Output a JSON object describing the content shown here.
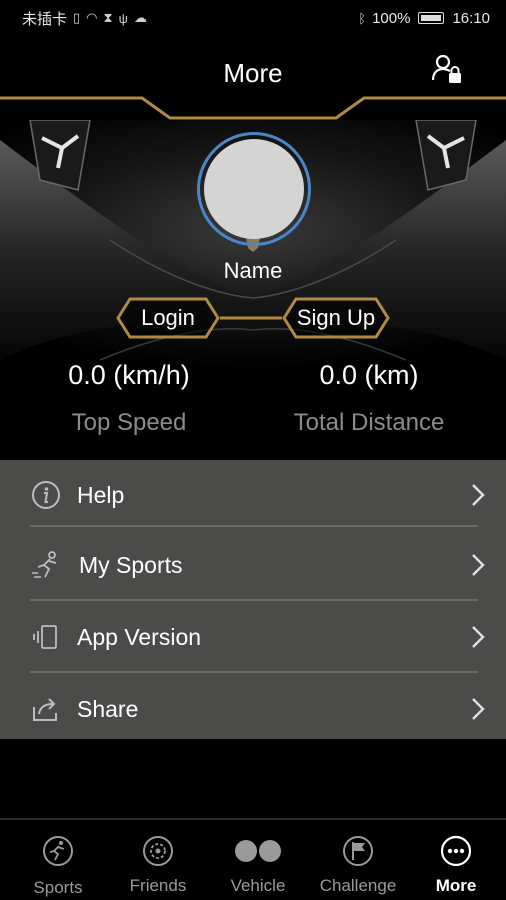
{
  "status_bar": {
    "carrier": "未插卡",
    "battery_percent": "100%",
    "time": "16:10"
  },
  "header": {
    "title": "More",
    "accent_color": "#b08a45"
  },
  "profile": {
    "name": "Name",
    "login_label": "Login",
    "signup_label": "Sign Up",
    "avatar_ring_color": "#4b86c9"
  },
  "stats": {
    "top_speed_value": "0.0 (km/h)",
    "top_speed_label": "Top Speed",
    "total_distance_value": "0.0 (km)",
    "total_distance_label": "Total Distance"
  },
  "menu": {
    "items": [
      {
        "label": "Help",
        "icon": "info-icon"
      },
      {
        "label": "My Sports",
        "icon": "runner-icon"
      },
      {
        "label": "App Version",
        "icon": "phone-version-icon"
      },
      {
        "label": "Share",
        "icon": "share-icon"
      }
    ]
  },
  "bottom_nav": {
    "items": [
      {
        "label": "Sports",
        "icon": "sports-icon",
        "active": false
      },
      {
        "label": "Friends",
        "icon": "friends-icon",
        "active": false
      },
      {
        "label": "Vehicle",
        "icon": "vehicle-icon",
        "active": false
      },
      {
        "label": "Challenge",
        "icon": "challenge-flag-icon",
        "active": false
      },
      {
        "label": "More",
        "icon": "more-dots-icon",
        "active": true
      }
    ]
  }
}
